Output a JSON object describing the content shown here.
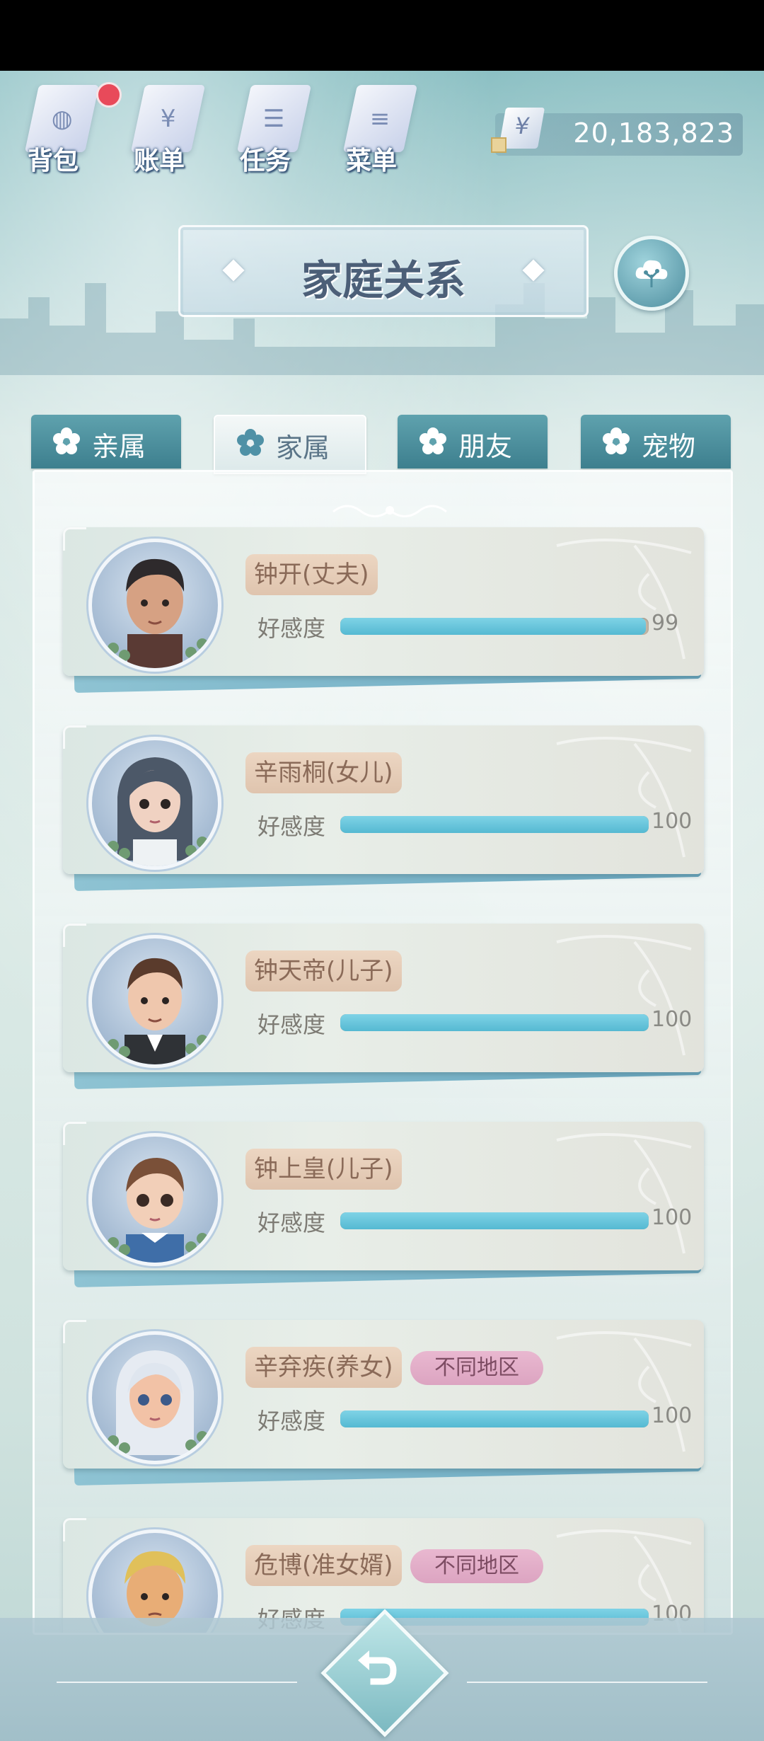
{
  "top_menu": [
    {
      "label": "背包",
      "icon": "backpack-icon",
      "has_notification": true
    },
    {
      "label": "账单",
      "icon": "bill-icon",
      "has_notification": false
    },
    {
      "label": "任务",
      "icon": "task-icon",
      "has_notification": false
    },
    {
      "label": "菜单",
      "icon": "menu-icon",
      "has_notification": false
    }
  ],
  "money": {
    "symbol": "¥",
    "amount": "20,183,823"
  },
  "title": "家庭关系",
  "tabs": [
    {
      "label": "亲属",
      "active": false
    },
    {
      "label": "家属",
      "active": true
    },
    {
      "label": "朋友",
      "active": false
    },
    {
      "label": "宠物",
      "active": false
    }
  ],
  "affection_label": "好感度",
  "members": [
    {
      "name": "钟开(丈夫)",
      "affection": 99,
      "affection_text": "99",
      "region_tag": null
    },
    {
      "name": "辛雨桐(女儿)",
      "affection": 100,
      "affection_text": "100",
      "region_tag": null
    },
    {
      "name": "钟天帝(儿子)",
      "affection": 100,
      "affection_text": "100",
      "region_tag": null
    },
    {
      "name": "钟上皇(儿子)",
      "affection": 100,
      "affection_text": "100",
      "region_tag": null
    },
    {
      "name": "辛弃疾(养女)",
      "affection": 100,
      "affection_text": "100",
      "region_tag": "不同地区"
    },
    {
      "name": "危博(准女婿)",
      "affection": 100,
      "affection_text": "100",
      "region_tag": "不同地区"
    }
  ],
  "colors": {
    "affection_fill": "#55b9d2",
    "name_pill": "#dfc4ae",
    "region_tag": "#dca4c1",
    "tab_inactive": "#3d7f8e"
  }
}
